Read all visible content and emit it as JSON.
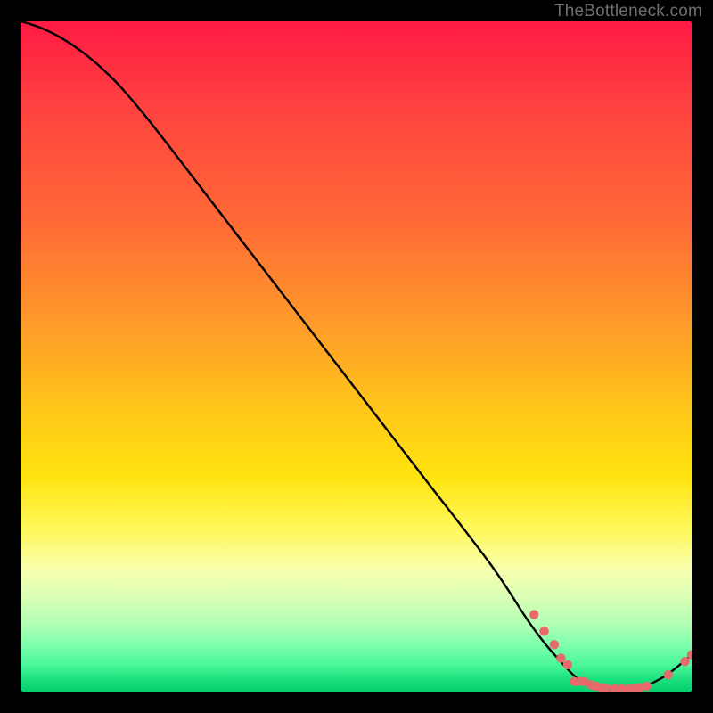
{
  "watermark": "TheBottleneck.com",
  "colors": {
    "curve": "#000000",
    "points_fill": "#e66a6a",
    "points_stroke": "#e66a6a"
  },
  "chart_data": {
    "type": "line",
    "title": "",
    "xlabel": "",
    "ylabel": "",
    "xlim": [
      0,
      100
    ],
    "ylim": [
      0,
      100
    ],
    "grid": false,
    "legend": false,
    "series": [
      {
        "name": "bottleneck-curve",
        "x": [
          0,
          3,
          6,
          9,
          12,
          15,
          20,
          30,
          40,
          50,
          60,
          70,
          76,
          80,
          84,
          88,
          92,
          96,
          100
        ],
        "y": [
          100,
          99,
          97.5,
          95.5,
          93,
          90,
          84,
          71,
          58,
          45,
          32,
          19,
          10,
          5,
          1.2,
          0.2,
          0.5,
          2.3,
          5.5
        ]
      }
    ],
    "points": [
      {
        "x": 76.5,
        "y": 11.5
      },
      {
        "x": 78.0,
        "y": 9.0
      },
      {
        "x": 79.5,
        "y": 7.0
      },
      {
        "x": 80.5,
        "y": 5.0
      },
      {
        "x": 81.5,
        "y": 4.0
      },
      {
        "x": 82.5,
        "y": 1.5
      },
      {
        "x": 83.3,
        "y": 1.5
      },
      {
        "x": 84.0,
        "y": 1.5
      },
      {
        "x": 85.0,
        "y": 1.0
      },
      {
        "x": 85.7,
        "y": 0.8
      },
      {
        "x": 86.5,
        "y": 0.6
      },
      {
        "x": 87.3,
        "y": 0.5
      },
      {
        "x": 88.5,
        "y": 0.4
      },
      {
        "x": 89.5,
        "y": 0.4
      },
      {
        "x": 90.5,
        "y": 0.4
      },
      {
        "x": 91.5,
        "y": 0.5
      },
      {
        "x": 92.3,
        "y": 0.6
      },
      {
        "x": 93.3,
        "y": 0.8
      },
      {
        "x": 96.5,
        "y": 2.5
      },
      {
        "x": 99.0,
        "y": 4.5
      },
      {
        "x": 100.0,
        "y": 5.5
      }
    ]
  }
}
